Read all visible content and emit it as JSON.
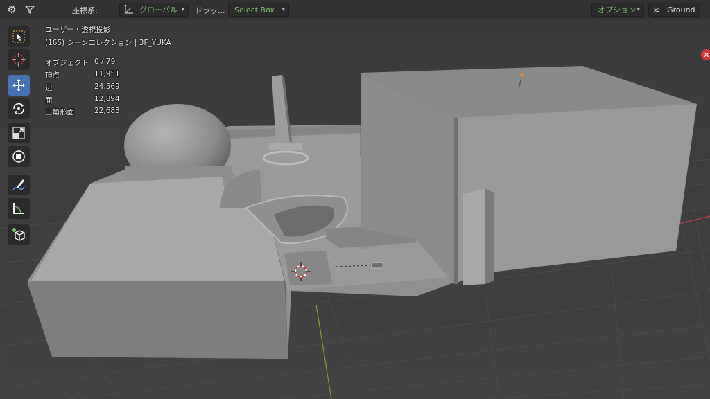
{
  "header": {
    "coord_label": "座標系:",
    "transform_orientation": "グローバル",
    "drag_label": "ドラッ...",
    "drag_mode": "Select Box",
    "options_label": "オプション",
    "snap_target": "Ground"
  },
  "toolbar": {
    "tools": [
      {
        "name": "select-box-tool",
        "icon": "select-box-icon",
        "active": false
      },
      {
        "name": "cursor-tool",
        "icon": "cursor-icon",
        "active": false
      },
      {
        "name": "move-tool",
        "icon": "move-icon",
        "active": true
      },
      {
        "name": "rotate-tool",
        "icon": "rotate-icon",
        "active": false
      },
      {
        "name": "scale-tool",
        "icon": "scale-icon",
        "active": false
      },
      {
        "name": "transform-tool",
        "icon": "transform-icon",
        "active": false
      },
      {
        "name": "annotate-tool",
        "icon": "annotate-icon",
        "active": false
      },
      {
        "name": "measure-tool",
        "icon": "measure-icon",
        "active": false
      },
      {
        "name": "add-cube-tool",
        "icon": "add-cube-icon",
        "active": false
      }
    ]
  },
  "overlay": {
    "view_name": "ユーザー・透視投影",
    "collection": "(165) シーンコレクション | 3F_YUKA",
    "stats": [
      {
        "label": "オブジェクト",
        "value": "0 / 79"
      },
      {
        "label": "頂点",
        "value": "11,951"
      },
      {
        "label": "辺",
        "value": "24,569"
      },
      {
        "label": "面",
        "value": "12,894"
      },
      {
        "label": "三角形面",
        "value": "22,683"
      }
    ]
  },
  "colors": {
    "accent": "#4772b3",
    "grid_x_axis": "#b8434a",
    "grid_y_axis": "#7a9a2e",
    "background": "#3d3d3d",
    "model_light": "#a8a8a8",
    "model_dark": "#6e6e6e",
    "close_badge": "#d8353d"
  }
}
